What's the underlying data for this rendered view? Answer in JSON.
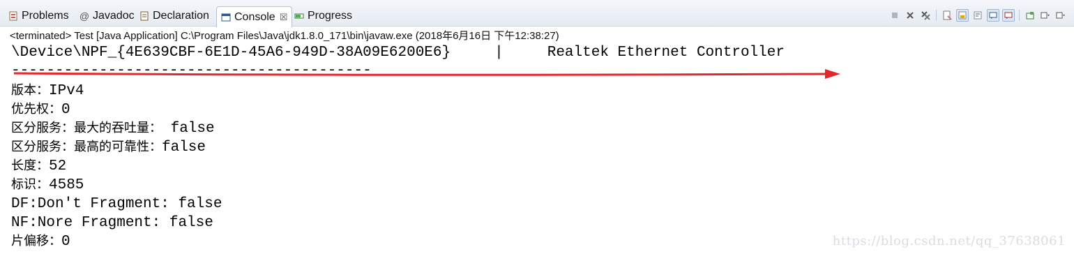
{
  "tabs": [
    {
      "label": "Problems",
      "icon": "problems-icon"
    },
    {
      "label": "Javadoc",
      "icon": "javadoc-icon"
    },
    {
      "label": "Declaration",
      "icon": "declaration-icon"
    },
    {
      "label": "Console",
      "icon": "console-icon",
      "active": true,
      "close": "☒"
    },
    {
      "label": "Progress",
      "icon": "progress-icon"
    }
  ],
  "toolbar_icons": [
    "terminate-icon",
    "remove-launch-icon",
    "remove-all-icon",
    "clear-console-icon",
    "scroll-lock-icon",
    "word-wrap-icon",
    "show-stdout-icon",
    "show-stderr-icon",
    "pin-console-icon",
    "display-console-icon",
    "new-console-icon"
  ],
  "status": "<terminated> Test [Java Application] C:\\Program Files\\Java\\jdk1.8.0_171\\bin\\javaw.exe (2018年6月16日 下午12:38:27)",
  "console": {
    "device_line": "\\Device\\NPF_{4E639CBF-6E1D-45A6-949D-38A09E6200E6}     |     Realtek Ethernet Controller",
    "dash_line": "-----------------------------------------",
    "lines": [
      {
        "label": "版本：",
        "value": "IPv4"
      },
      {
        "label": "优先权：",
        "value": "0"
      },
      {
        "label": "区分服务：最大的吞吐量：",
        "value": " false"
      },
      {
        "label": "区分服务：最高的可靠性：",
        "value": "false"
      },
      {
        "label": "长度：",
        "value": "52"
      },
      {
        "label": "标识：",
        "value": "4585"
      },
      {
        "label": "",
        "value": "DF:Don't Fragment: false"
      },
      {
        "label": "",
        "value": "NF:Nore Fragment: false"
      },
      {
        "label": "片偏移：",
        "value": "0"
      }
    ]
  },
  "colors": {
    "arrow": "#e5262b",
    "tabbar": "#e9eef5",
    "watermark": "#d9dce0"
  },
  "watermark": "https://blog.csdn.net/qq_37638061"
}
